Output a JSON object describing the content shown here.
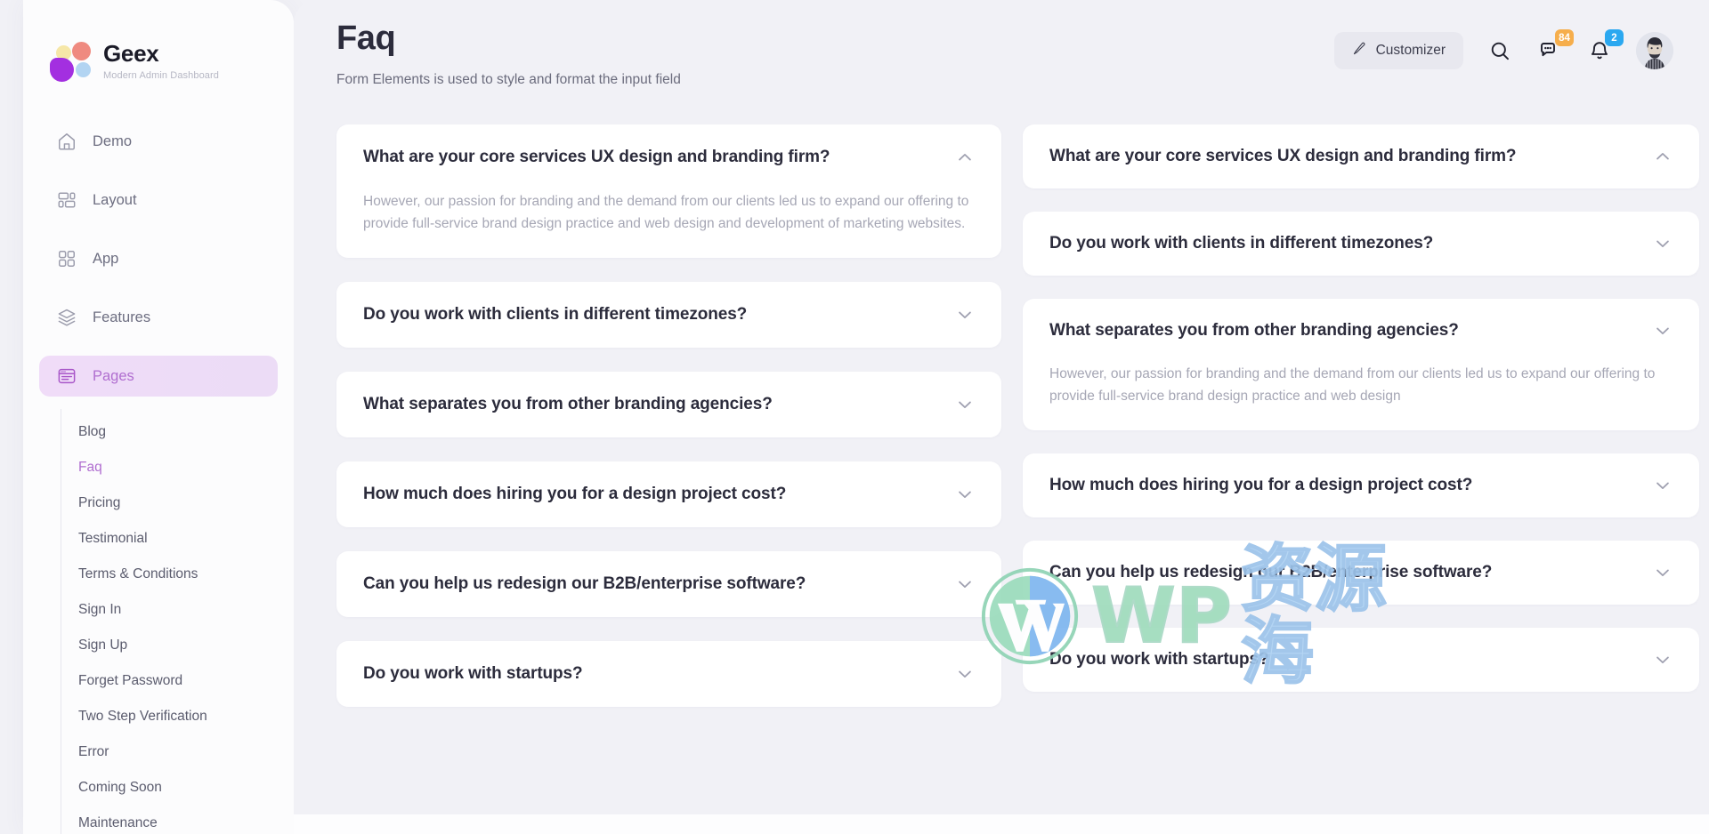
{
  "brand": {
    "name": "Geex",
    "tagline": "Modern Admin Dashboard",
    "logo_colors": {
      "yellow": "#f6e7a8",
      "salmon": "#ef8a80",
      "purple": "#a32fe0",
      "blue": "#b2d4f2"
    }
  },
  "sidebar": {
    "items": [
      {
        "label": "Demo",
        "icon": "home-icon",
        "active": false
      },
      {
        "label": "Layout",
        "icon": "layout-icon",
        "active": false
      },
      {
        "label": "App",
        "icon": "grid-icon",
        "active": false
      },
      {
        "label": "Features",
        "icon": "layers-icon",
        "active": false
      },
      {
        "label": "Pages",
        "icon": "browser-window-icon",
        "active": true
      }
    ],
    "submenu": [
      {
        "label": "Blog",
        "active": false
      },
      {
        "label": "Faq",
        "active": true
      },
      {
        "label": "Pricing",
        "active": false
      },
      {
        "label": "Testimonial",
        "active": false
      },
      {
        "label": "Terms & Conditions",
        "active": false
      },
      {
        "label": "Sign In",
        "active": false
      },
      {
        "label": "Sign Up",
        "active": false
      },
      {
        "label": "Forget Password",
        "active": false
      },
      {
        "label": "Two Step Verification",
        "active": false
      },
      {
        "label": "Error",
        "active": false
      },
      {
        "label": "Coming Soon",
        "active": false
      },
      {
        "label": "Maintenance",
        "active": false
      }
    ],
    "active_accent": "#b06ed0"
  },
  "header": {
    "title": "Faq",
    "subtitle": "Form Elements is used to style and format the input field"
  },
  "toolbar": {
    "customizer_label": "Customizer",
    "customizer_icon": "pencil-icon",
    "search_icon": "search-icon",
    "messages_icon": "chat-bubble-icon",
    "messages_badge": "84",
    "messages_badge_color": "#f6ae4c",
    "notifications_icon": "bell-icon",
    "notifications_badge": "2",
    "notifications_badge_color": "#2ba8f0",
    "avatar_label": "avatar"
  },
  "faq": {
    "left_column": [
      {
        "question": "What are your core services UX design and branding firm?",
        "answer": "However, our passion for branding and the demand from our clients led us to expand our offering to provide full-service brand design practice and web design and development of marketing websites.",
        "expanded": true,
        "chevron": "chevron-up-icon"
      },
      {
        "question": "Do you work with clients in different timezones?",
        "answer": "",
        "expanded": false,
        "chevron": "chevron-down-icon"
      },
      {
        "question": "What separates you from other branding agencies?",
        "answer": "",
        "expanded": false,
        "chevron": "chevron-down-icon"
      },
      {
        "question": "How much does hiring you for a design project cost?",
        "answer": "",
        "expanded": false,
        "chevron": "chevron-down-icon"
      },
      {
        "question": "Can you help us redesign our B2B/enterprise software?",
        "answer": "",
        "expanded": false,
        "chevron": "chevron-down-icon"
      },
      {
        "question": "Do you work with startups?",
        "answer": "",
        "expanded": false,
        "chevron": "chevron-down-icon"
      }
    ],
    "right_column": [
      {
        "question": "What are your core services UX design and branding firm?",
        "answer": "",
        "expanded": false,
        "chevron": "chevron-up-icon"
      },
      {
        "question": "Do you work with clients in different timezones?",
        "answer": "",
        "expanded": false,
        "chevron": "chevron-down-icon"
      },
      {
        "question": "What separates you from other branding agencies?",
        "answer": "However, our passion for branding and the demand from our clients led us to expand our offering to provide full-service brand design practice and web design",
        "expanded": true,
        "chevron": "chevron-down-icon"
      },
      {
        "question": "How much does hiring you for a design project cost?",
        "answer": "",
        "expanded": false,
        "chevron": "chevron-down-icon"
      },
      {
        "question": "Can you help us redesign our B2B/enterprise software?",
        "answer": "",
        "expanded": false,
        "chevron": "chevron-down-icon"
      },
      {
        "question": "Do you work with startups?",
        "answer": "",
        "expanded": false,
        "chevron": "chevron-down-icon"
      }
    ]
  },
  "watermark": {
    "latin": "WP",
    "cjk": "资源海",
    "mark": "wordpress-logo-icon",
    "latin_color": "#9fdcbc",
    "cjk_color": "#aed2f3"
  }
}
